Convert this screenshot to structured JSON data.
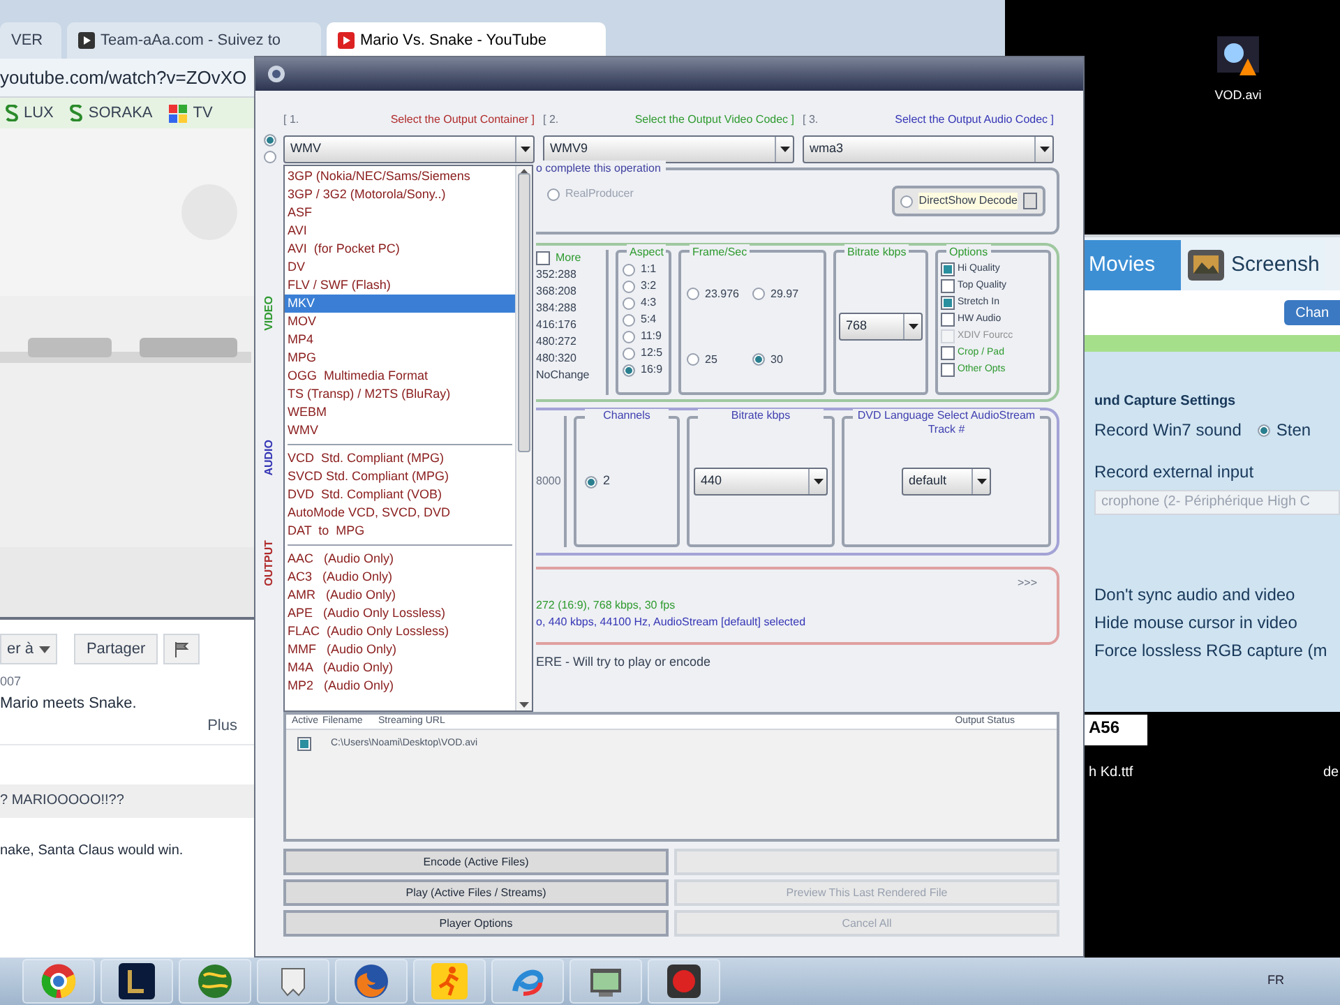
{
  "browser": {
    "tabs": [
      {
        "label": "VER",
        "selected": false
      },
      {
        "label": "Team-aAa.com - Suivez to",
        "selected": false
      },
      {
        "label": "Mario Vs. Snake - YouTube",
        "selected": true
      }
    ],
    "address": "youtube.com/watch?v=ZOvXO",
    "bookmarks": [
      "LUX",
      "SORAKA",
      "TV"
    ],
    "video": {
      "kind": "picture"
    },
    "actions": [
      "er à",
      "Partager"
    ],
    "date": "007",
    "description": "Mario meets Snake.",
    "more": "Plus",
    "comments": [
      "? MARIOOOOO!!??",
      "nake, Santa Claus would win."
    ]
  },
  "converter": {
    "source_radios": [
      {
        "selected": true
      },
      {
        "selected": false
      }
    ],
    "side_labels": [
      {
        "label": "VIDEO",
        "color": "#2e9a2e"
      },
      {
        "label": "AUDIO",
        "color": "#3535b5"
      },
      {
        "label": "OUTPUT",
        "color": "#b02a2a"
      }
    ],
    "steps": [
      {
        "number": "[ 1.",
        "label": "Select the Output Container ]",
        "color": "#b02a2a",
        "value": "WMV"
      },
      {
        "number": "[ 2.",
        "label": "Select the Output Video Codec ]",
        "color": "#2e9a2e",
        "value": "WMV9"
      },
      {
        "number": "[ 3.",
        "label": "Select the Output Audio Codec ]",
        "color": "#3535b5",
        "value": "wma3"
      }
    ],
    "container_list": [
      [
        {
          "label": "3GP (Nokia/NEC/Sams/Siemens",
          "selected": false
        },
        {
          "label": "3GP / 3G2 (Motorola/Sony..)",
          "selected": false
        },
        {
          "label": "ASF",
          "selected": false
        },
        {
          "label": "AVI",
          "selected": false
        },
        {
          "label": "AVI  (for Pocket PC)",
          "selected": false
        },
        {
          "label": "DV",
          "selected": false
        },
        {
          "label": "FLV / SWF (Flash)",
          "selected": false
        },
        {
          "label": "MKV",
          "selected": true
        },
        {
          "label": "MOV",
          "selected": false
        },
        {
          "label": "MP4",
          "selected": false
        },
        {
          "label": "MPG",
          "selected": false
        },
        {
          "label": "OGG  Multimedia Format",
          "selected": false
        },
        {
          "label": "TS (Transp) / M2TS (BluRay)",
          "selected": false
        },
        {
          "label": "WEBM",
          "selected": false
        },
        {
          "label": "WMV",
          "selected": false
        }
      ],
      [
        {
          "label": "VCD  Std. Compliant (MPG)",
          "selected": false
        },
        {
          "label": "SVCD Std. Compliant (MPG)",
          "selected": false
        },
        {
          "label": "DVD  Std. Compliant (VOB)",
          "selected": false
        },
        {
          "label": "AutoMode VCD, SVCD, DVD",
          "selected": false
        },
        {
          "label": "DAT  to  MPG",
          "selected": false
        }
      ],
      [
        {
          "label": "AAC   (Audio Only)",
          "selected": false
        },
        {
          "label": "AC3   (Audio Only)",
          "selected": false
        },
        {
          "label": "AMR   (Audio Only)",
          "selected": false
        },
        {
          "label": "APE   (Audio Only Lossless)",
          "selected": false
        },
        {
          "label": "FLAC  (Audio Only Lossless)",
          "selected": false
        },
        {
          "label": "MMF   (Audio Only)",
          "selected": false
        },
        {
          "label": "M4A   (Audio Only)",
          "selected": false
        },
        {
          "label": "MP2   (Audio Only)",
          "selected": false
        }
      ]
    ],
    "operation": {
      "legend": "o complete this operation",
      "option": {
        "label": "RealProducer",
        "selected": false
      },
      "decode_button": "DirectShow Decode"
    },
    "video": {
      "more": {
        "label": "More",
        "checked": false
      },
      "sizes": [
        "352:288",
        "368:208",
        "384:288",
        "416:176",
        "480:272",
        "480:320",
        "NoChange"
      ],
      "aspect": {
        "title": "Aspect",
        "items": [
          {
            "label": "1:1",
            "selected": false
          },
          {
            "label": "3:2",
            "selected": false
          },
          {
            "label": "4:3",
            "selected": false
          },
          {
            "label": "5:4",
            "selected": false
          },
          {
            "label": "11:9",
            "selected": false
          },
          {
            "label": "12:5",
            "selected": false
          },
          {
            "label": "16:9",
            "selected": true
          }
        ]
      },
      "fps": {
        "title": "Frame/Sec",
        "items": [
          {
            "label": "23.976",
            "selected": false
          },
          {
            "label": "29.97",
            "selected": false
          },
          {
            "label": "25",
            "selected": false
          },
          {
            "label": "30",
            "selected": true
          }
        ]
      },
      "bitrate": {
        "title": "Bitrate  kbps",
        "value": "768"
      },
      "options": {
        "title": "Options",
        "items": [
          {
            "label": "Hi Quality",
            "checked": true,
            "disabled": false
          },
          {
            "label": "Top Quality",
            "checked": false,
            "disabled": false
          },
          {
            "label": "Stretch In",
            "checked": true,
            "disabled": false
          },
          {
            "label": "HW Audio",
            "checked": false,
            "disabled": false
          },
          {
            "label": "XDIV Fourcc",
            "checked": false,
            "disabled": true
          },
          {
            "label": "Crop / Pad",
            "checked": false,
            "disabled": false
          },
          {
            "label": "Other Opts",
            "checked": false,
            "disabled": false
          }
        ]
      }
    },
    "audio": {
      "rate_fragment": "8000",
      "channels": {
        "title": "Channels",
        "option": {
          "label": "2",
          "selected": true
        }
      },
      "bitrate": {
        "title": "Bitrate  kbps",
        "value": "440"
      },
      "language": {
        "title": "DVD Language Select AudioStream  Track #",
        "value": "default"
      }
    },
    "summary": {
      "expand": ">>>",
      "video_line": "272 (16:9),  768 kbps,  30 fps",
      "audio_line": "o,  440 kbps,  44100 Hz,  AudioStream [default] selected"
    },
    "hint": "ERE - Will try to play or encode",
    "files": {
      "columns": [
        "Active",
        "Filename",
        "Streaming URL",
        "Output Status"
      ],
      "rows": [
        {
          "active": true,
          "filename": "C:\\Users\\Noami\\Desktop\\VOD.avi"
        }
      ]
    },
    "buttons": [
      {
        "label": "Encode (Active Files)",
        "disabled": false
      },
      {
        "disabled": true
      },
      {
        "label": "Play (Active Files / Streams)",
        "disabled": false
      },
      {
        "label": "Preview This Last Rendered File",
        "disabled": true
      },
      {
        "label": "Player Options",
        "disabled": false
      },
      {
        "label": "Cancel All",
        "disabled": true
      }
    ]
  },
  "desktop_icons": [
    {
      "label": "VOD.avi"
    }
  ],
  "capture": {
    "tabs": [
      {
        "label": "Movies",
        "selected": true
      },
      {
        "label": "Screensh",
        "selected": false
      }
    ],
    "button": "Chan",
    "section": "und Capture Settings",
    "sources": [
      "Record Win7 sound",
      "Record external input"
    ],
    "stereo": {
      "label": "Sten",
      "selected": true
    },
    "device": "crophone (2- Périphérique High C",
    "flags": [
      "Don't sync audio and video",
      "Hide mouse cursor in video",
      "Force lossless RGB capture (m"
    ]
  },
  "desktop_labels": [
    "A56",
    "h Kd.ttf",
    "de"
  ],
  "taskbar": {
    "language": "FR"
  }
}
